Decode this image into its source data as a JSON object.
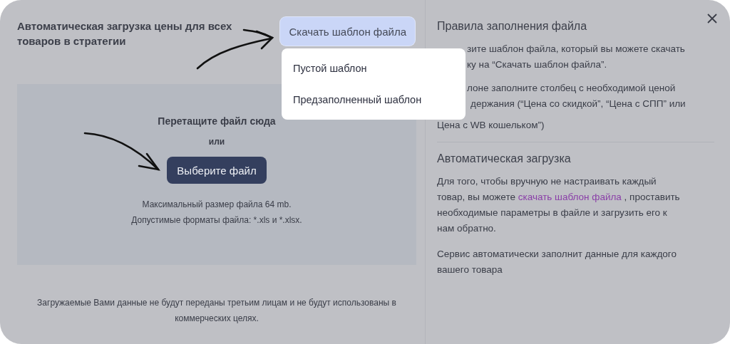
{
  "title": "Автоматическая загрузка цены для всех товаров в стратегии",
  "download_button": {
    "label": "Скачать шаблон файла",
    "expanded": true
  },
  "dropdown": {
    "items": [
      {
        "label": "Пустой шаблон"
      },
      {
        "label": "Предзаполненный шаблон"
      }
    ]
  },
  "dropzone": {
    "heading": "Перетащите файл сюда",
    "or": "или",
    "button": "Выберите файл",
    "max_size": "Максимальный размер файла 64 mb.",
    "formats": "Допустимые форматы файла: *.xls и *.xlsx."
  },
  "footer_note": "Загружаемые Вами данные не будут переданы третьим лицам и не будут использованы в коммерческих целях.",
  "rules": {
    "heading": "Правила заполнения файла",
    "lines": [
      "зите шаблон файла, который вы можете скачать",
      "ку на “Скачать шаблон файла”.",
      "лоне заполните столбец с необходимой ценой",
      "держания (“Цена со скидкой”, “Цена с СПП” или",
      "Цена с WB кошельком”)"
    ]
  },
  "auto": {
    "heading": "Автоматическая загрузка",
    "before": "Для того, чтобы вручную не настраивать каждый товар, вы можете ",
    "link": "скачать шаблон файла",
    "after": " , проставить необходимые параметры в файле и загрузить его к нам обратно.",
    "note": "Сервис автоматически заполнит данные для каждого вашего товара"
  }
}
